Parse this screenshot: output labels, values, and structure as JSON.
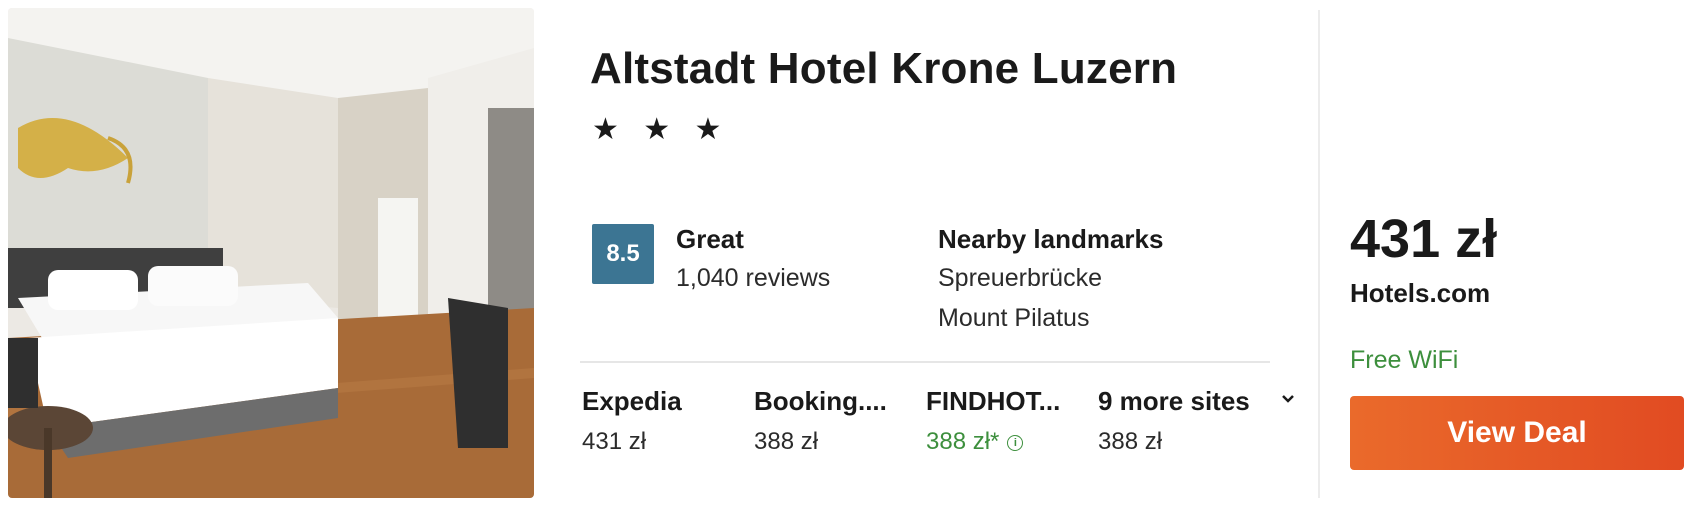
{
  "hotel": {
    "name": "Altstadt Hotel Krone Luzern",
    "stars": "★ ★ ★",
    "score": "8.5",
    "rating_word": "Great",
    "review_count": "1,040 reviews"
  },
  "landmarks": {
    "heading": "Nearby landmarks",
    "items": [
      "Spreuerbrücke",
      "Mount Pilatus"
    ]
  },
  "deals": [
    {
      "site": "Expedia",
      "price": "431 zł"
    },
    {
      "site": "Booking....",
      "price": "388 zł"
    },
    {
      "site": "FINDHOT...",
      "price": "388 zł*"
    },
    {
      "site": "9 more sites",
      "price": "388 zł"
    }
  ],
  "best_deal": {
    "price": "431 zł",
    "provider": "Hotels.com",
    "amenity": "Free WiFi",
    "button_label": "View Deal"
  },
  "colors": {
    "score_badge": "#3c7593",
    "button": "#e14b22",
    "green_text": "#3d8f3d"
  }
}
